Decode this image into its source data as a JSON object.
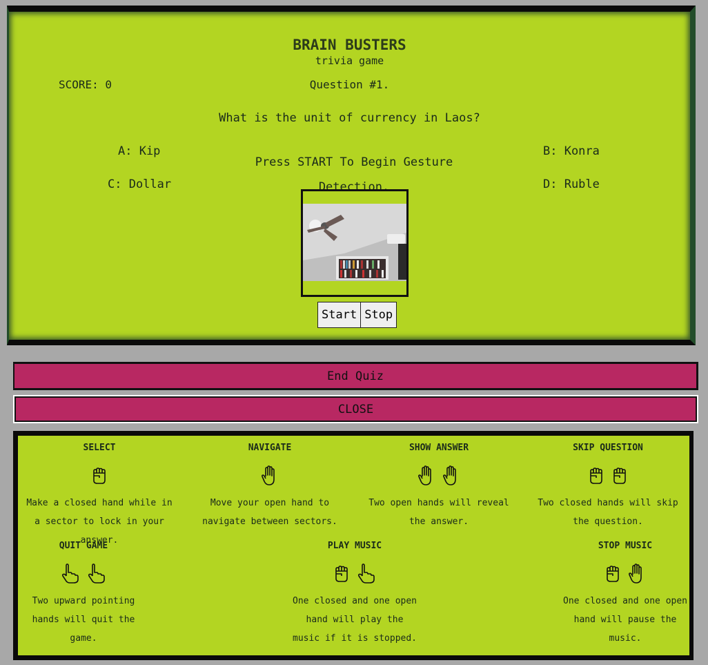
{
  "game": {
    "title": "BRAIN BUSTERS",
    "subtitle": "trivia game",
    "score_label": "SCORE: 0",
    "question_number": "Question #1.",
    "question": "What is the unit of currency in Laos?",
    "options": {
      "a": "A: Kip",
      "b": "B: Konra",
      "c": "C: Dollar",
      "d": "D: Ruble"
    },
    "instruction": "Press START To Begin Gesture Detection.",
    "start_label": "Start",
    "stop_label": "Stop"
  },
  "actions": {
    "end_quiz": "End Quiz",
    "close": "CLOSE"
  },
  "gestures": [
    {
      "title": "SELECT",
      "icons": [
        "fist-icon"
      ],
      "desc": "Make a closed hand while in a sector to lock in your answer."
    },
    {
      "title": "NAVIGATE",
      "icons": [
        "open-hand-icon"
      ],
      "desc": "Move your open hand to navigate between sectors."
    },
    {
      "title": "SHOW ANSWER",
      "icons": [
        "open-hand-icon",
        "open-hand-icon"
      ],
      "desc": "Two open hands will reveal the answer."
    },
    {
      "title": "SKIP QUESTION",
      "icons": [
        "fist-icon",
        "fist-icon"
      ],
      "desc": "Two closed hands will skip the question."
    },
    {
      "title": "QUIT GAME",
      "icons": [
        "pointing-up-icon",
        "pointing-up-icon"
      ],
      "desc": "Two upward pointing hands will quit the game."
    },
    {
      "title": "PLAY MUSIC",
      "icons": [
        "fist-icon",
        "pointing-up-icon"
      ],
      "desc": "One closed and one open hand will play the music if it is stopped."
    },
    {
      "title": "STOP MUSIC",
      "icons": [
        "fist-icon",
        "open-hand-icon"
      ],
      "desc": "One closed and one open hand will pause the music."
    }
  ],
  "colors": {
    "panel": "#b3d522",
    "accent": "#b82862",
    "background": "#a8a8a8"
  }
}
